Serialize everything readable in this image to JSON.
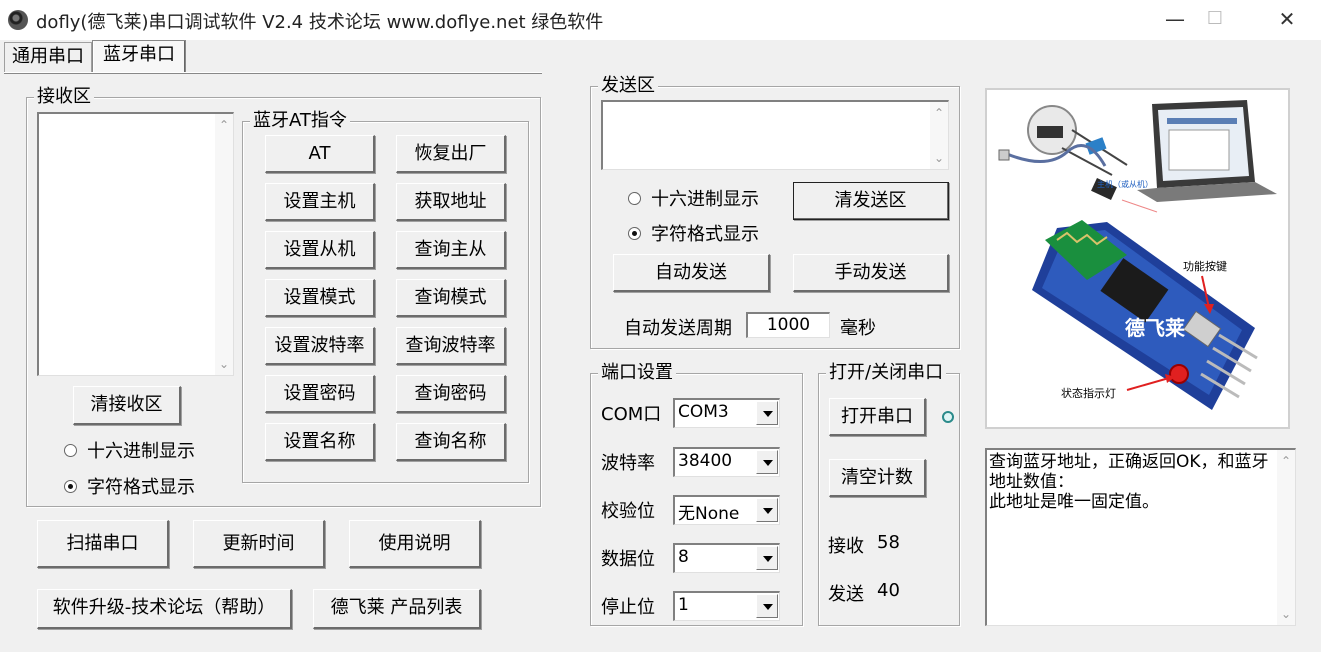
{
  "window": {
    "title": "dofly(德飞莱)串口调试软件 V2.4 技术论坛 www.doflye.net 绿色软件",
    "minimize": "—",
    "maximize": "☐",
    "close": "✕"
  },
  "tabs": [
    {
      "label": "通用串口",
      "active": false
    },
    {
      "label": "蓝牙串口",
      "active": true
    }
  ],
  "receive": {
    "legend": "接收区",
    "content": "",
    "clear_label": "清接收区",
    "radio_hex": "十六进制显示",
    "radio_char": "字符格式显示",
    "selected": "char"
  },
  "at": {
    "legend": "蓝牙AT指令",
    "buttons": [
      "AT",
      "恢复出厂",
      "设置主机",
      "获取地址",
      "设置从机",
      "查询主从",
      "设置模式",
      "查询模式",
      "设置波特率",
      "查询波特率",
      "设置密码",
      "查询密码",
      "设置名称",
      "查询名称"
    ]
  },
  "bottom_buttons": [
    "扫描串口",
    "更新时间",
    "使用说明",
    "软件升级-技术论坛（帮助）",
    "德飞莱 产品列表"
  ],
  "send": {
    "legend": "发送区",
    "content": "",
    "radio_hex": "十六进制显示",
    "radio_char": "字符格式显示",
    "selected": "char",
    "clear_label": "清发送区",
    "auto_send_label": "自动发送",
    "manual_send_label": "手动发送",
    "period_label": "自动发送周期",
    "period_value": "1000",
    "period_unit": "毫秒"
  },
  "port": {
    "legend": "端口设置",
    "com_label": "COM口",
    "com_value": "COM3",
    "baud_label": "波特率",
    "baud_value": "38400",
    "parity_label": "校验位",
    "parity_value": "无None",
    "data_label": "数据位",
    "data_value": "8",
    "stop_label": "停止位",
    "stop_value": "1"
  },
  "open_close": {
    "legend": "打开/关闭串口",
    "open_label": "打开串口",
    "clear_count_label": "清空计数",
    "recv_label": "接收",
    "recv_count": "58",
    "send_label": "发送",
    "send_count": "40"
  },
  "picture": {
    "host_caption": "主机（或从机）",
    "function_key": "功能按键",
    "status_led": "状态指示灯",
    "watermark": "德飞莱"
  },
  "info": {
    "text": "查询蓝牙地址，正确返回OK，和蓝牙地址数值：\n此地址是唯一固定值。"
  },
  "colors": {
    "window_bg": "#f0f0f0",
    "led": "#2a8a8a",
    "pcb_blue": "#1f3f9a",
    "arrow_red": "#e02020"
  }
}
